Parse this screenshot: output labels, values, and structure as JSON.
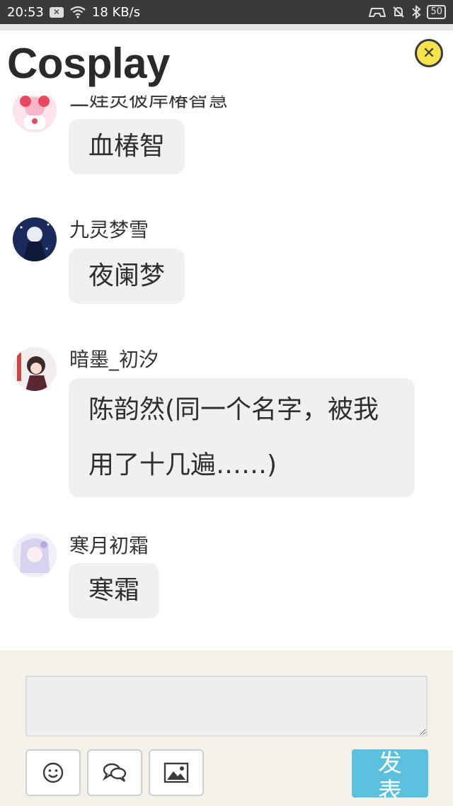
{
  "status_bar": {
    "time": "20:53",
    "notification_icon": "x-box-icon",
    "network_speed": "18 KB/s",
    "battery": "50"
  },
  "header": {
    "title": "Cosplay",
    "close_icon": "close-circle-icon"
  },
  "messages": [
    {
      "name": "二娃灵彼岸椿智慧",
      "text": "血椿智"
    },
    {
      "name": "九灵梦雪",
      "text": "夜阑梦"
    },
    {
      "name": "暗墨_初汐",
      "text": "陈韵然(同一个名字，被我用了十几遍……)"
    },
    {
      "name": "寒月初霜",
      "text": "寒霜"
    }
  ],
  "composer": {
    "input_value": "",
    "emoji_icon": "smiley-icon",
    "chat_icon": "speech-bubbles-icon",
    "image_icon": "image-icon",
    "send_label": "发表"
  },
  "colors": {
    "status_bar": "#3a3a3a",
    "close_button": "#f7e44c",
    "bubble": "#f0f0f0",
    "composer_bg": "#f3f1ea",
    "send_button": "#5bc0de"
  }
}
